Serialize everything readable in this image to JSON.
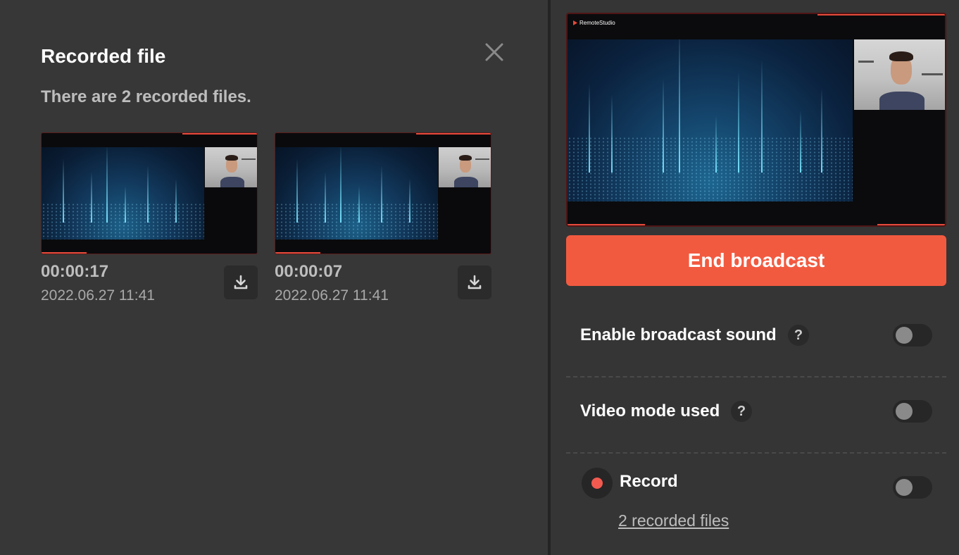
{
  "recorded_panel": {
    "title": "Recorded file",
    "subtitle": "There are 2 recorded files.",
    "close_icon": "close-icon",
    "files": [
      {
        "duration": "00:00:17",
        "date": "2022.06.27 11:41",
        "download_icon": "download-icon"
      },
      {
        "duration": "00:00:07",
        "date": "2022.06.27 11:41",
        "download_icon": "download-icon"
      }
    ]
  },
  "preview": {
    "brand": "RemoteStudio"
  },
  "controls": {
    "end_broadcast": "End broadcast",
    "broadcast_sound": {
      "label": "Enable broadcast sound",
      "help": "?",
      "enabled": false
    },
    "video_mode": {
      "label": "Video mode used",
      "help": "?",
      "enabled": false
    },
    "record": {
      "label": "Record",
      "enabled": false,
      "link": "2 recorded files"
    }
  },
  "colors": {
    "accent": "#f25a40",
    "background": "#353535",
    "record_dot": "#f25a50"
  }
}
